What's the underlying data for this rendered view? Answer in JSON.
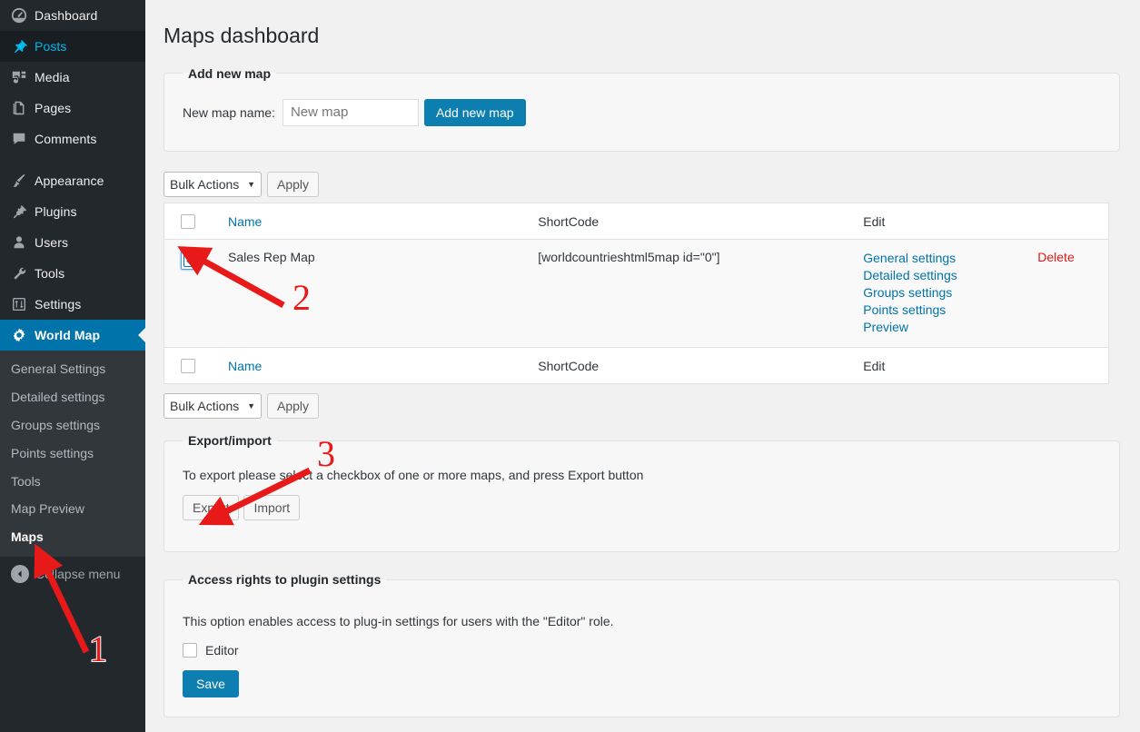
{
  "sidebar": {
    "items": [
      {
        "label": "Dashboard",
        "icon": "dashboard-icon",
        "state": "normal"
      },
      {
        "label": "Posts",
        "icon": "pin-icon",
        "state": "hovered"
      },
      {
        "label": "Media",
        "icon": "media-icon",
        "state": "normal"
      },
      {
        "label": "Pages",
        "icon": "pages-icon",
        "state": "normal"
      },
      {
        "label": "Comments",
        "icon": "comments-icon",
        "state": "normal"
      },
      {
        "label": "Appearance",
        "icon": "brush-icon",
        "state": "normal"
      },
      {
        "label": "Plugins",
        "icon": "plug-icon",
        "state": "normal"
      },
      {
        "label": "Users",
        "icon": "user-icon",
        "state": "normal"
      },
      {
        "label": "Tools",
        "icon": "wrench-icon",
        "state": "normal"
      },
      {
        "label": "Settings",
        "icon": "sliders-icon",
        "state": "normal"
      },
      {
        "label": "World Map",
        "icon": "gear-icon",
        "state": "current"
      }
    ],
    "submenu": [
      {
        "label": "General Settings",
        "active": false
      },
      {
        "label": "Detailed settings",
        "active": false
      },
      {
        "label": "Groups settings",
        "active": false
      },
      {
        "label": "Points settings",
        "active": false
      },
      {
        "label": "Tools",
        "active": false
      },
      {
        "label": "Map Preview",
        "active": false
      },
      {
        "label": "Maps",
        "active": true
      }
    ],
    "collapse_label": "Collapse menu",
    "collapse_icon": "chevron-left-circle-icon",
    "bg_color": "#23282d",
    "submenu_bg_color": "#32373c",
    "accent_color": "#0073aa",
    "hover_text_color": "#00b9eb"
  },
  "page": {
    "title": "Maps dashboard"
  },
  "add_new_map": {
    "legend": "Add new map",
    "field_label": "New map name:",
    "input_value": "New map",
    "input_placeholder": "New map",
    "button_label": "Add new map",
    "button_color": "#0c7fb0"
  },
  "tablenav_top": {
    "bulk_selected": "Bulk Actions",
    "bulk_options": [
      "Bulk Actions"
    ],
    "caret_icon": "chevron-down-icon",
    "apply_label": "Apply"
  },
  "tablenav_bottom": {
    "bulk_selected": "Bulk Actions",
    "bulk_options": [
      "Bulk Actions"
    ],
    "caret_icon": "chevron-down-icon",
    "apply_label": "Apply"
  },
  "maps_table": {
    "columns": {
      "checkbox": "",
      "name": "Name",
      "shortcode": "ShortCode",
      "edit": "Edit",
      "delete": ""
    },
    "rows": [
      {
        "checked": true,
        "name": "Sales Rep Map",
        "shortcode": "[worldcountrieshtml5map id=\"0\"]",
        "edit_links": [
          "General settings",
          "Detailed settings",
          "Groups settings",
          "Points settings",
          "Preview"
        ],
        "delete_label": "Delete"
      }
    ],
    "link_color": "#0073aa",
    "delete_color": "#e01a1a"
  },
  "export_import": {
    "legend": "Export/import",
    "description": "To export please select a checkbox of one or more maps, and press Export button",
    "export_label": "Export",
    "import_label": "Import"
  },
  "access_rights": {
    "legend": "Access rights to plugin settings",
    "description": "This option enables access to plug-in settings for users with the \"Editor\" role.",
    "checkbox_label": "Editor",
    "checkbox_checked": false,
    "save_label": "Save"
  },
  "annotations": {
    "color": "#e81919",
    "markers": [
      {
        "number": "1",
        "target": "sidebar-item-maps"
      },
      {
        "number": "2",
        "target": "row-checkbox"
      },
      {
        "number": "3",
        "target": "export-button"
      }
    ]
  }
}
